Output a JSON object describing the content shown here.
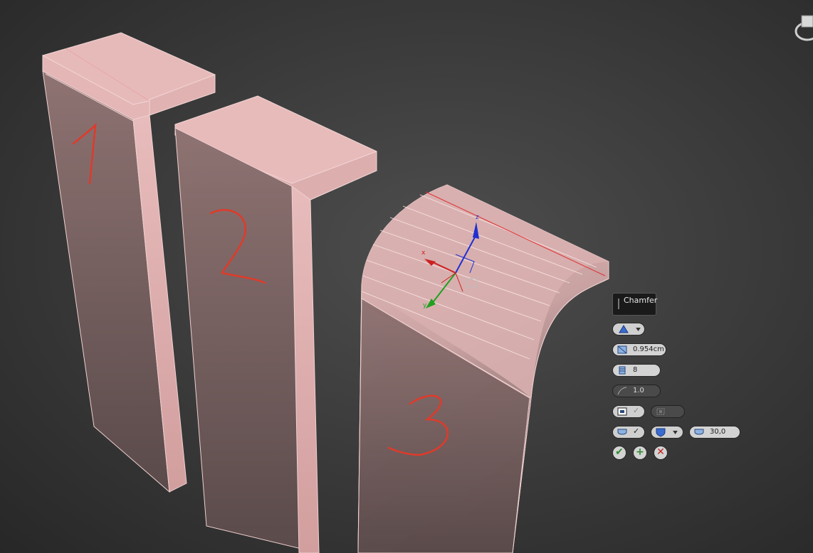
{
  "caddy": {
    "title": "Chamfer",
    "mode_icon": "triangle-icon",
    "amount": "0.954cm",
    "segments": "8",
    "tension": "1.0",
    "smooth_threshold": "30,0",
    "buttons": {
      "ok": "✔",
      "apply_continue": "+",
      "cancel": "✕"
    }
  },
  "viewport": {
    "annotations": [
      "1",
      "2",
      "3"
    ],
    "gizmo_axes": {
      "x": "x",
      "y": "y",
      "z": "z"
    }
  },
  "colors": {
    "object_face": "#c9a3a3",
    "object_top": "#e6b9b9",
    "edge_selected": "#e03030",
    "axis_x": "#cc2020",
    "axis_y": "#20a020",
    "axis_z": "#2030d0",
    "annotation_ink": "#e03a2a"
  }
}
